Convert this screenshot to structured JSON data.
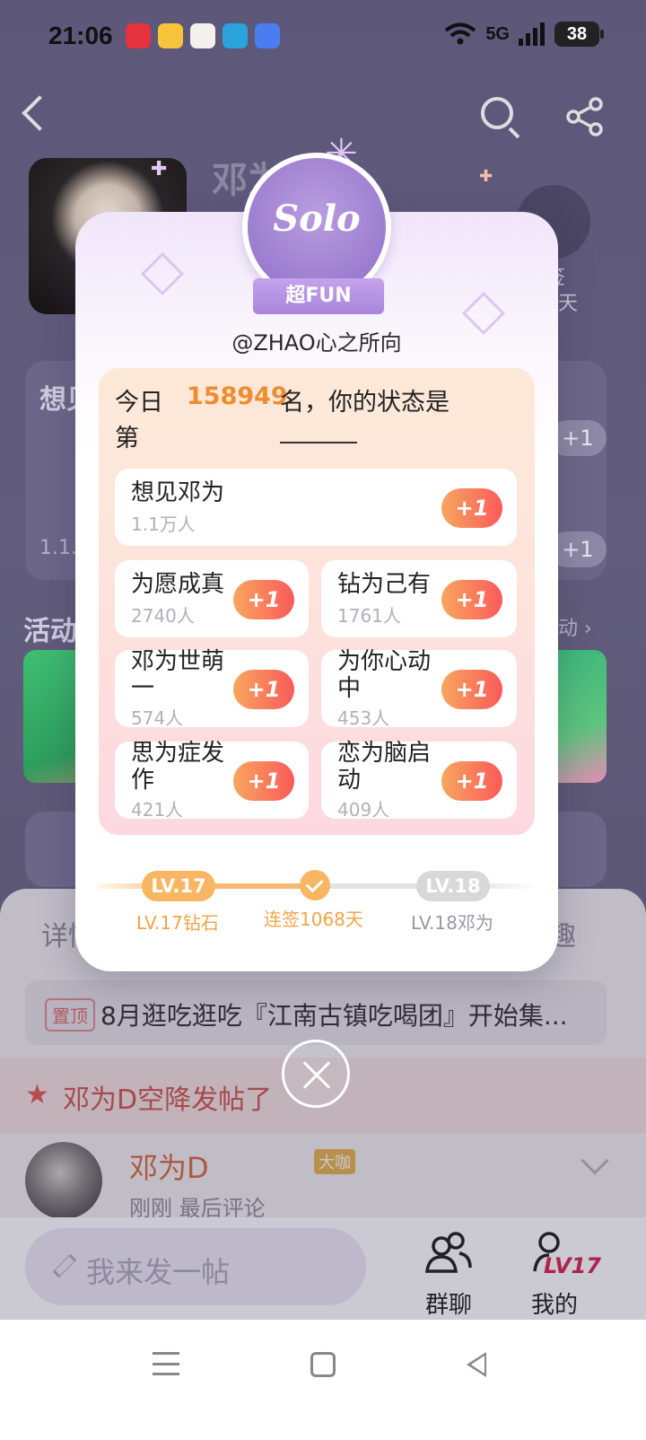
{
  "status_bar": {
    "time": "21:06",
    "network": "5G",
    "battery": "38",
    "app_icons": [
      "xiaohongshu-icon",
      "weibo-icon",
      "avatar-app-icon",
      "telegram-icon",
      "star-app-icon"
    ],
    "app_icon_colors": [
      "#e5323c",
      "#f6c43a",
      "#f4f0ee",
      "#2aa3dd",
      "#4b7df0"
    ]
  },
  "background": {
    "title": "邓为",
    "checkin_label": "签",
    "checkin_days": "8天",
    "section_want": "想见",
    "count_partial": "1.1...",
    "activity_title": "活动",
    "activity_more": "动 ›"
  },
  "modal": {
    "badge_text": "Solo",
    "ribbon": "超FUN",
    "handle": "@ZHAO心之所向",
    "rank_prefix_1": "今日",
    "rank_prefix_2": "第",
    "rank_number": "158949",
    "rank_suffix": "名，你的状态是",
    "options": [
      {
        "label": "想见邓为",
        "count": "1.1万人",
        "action": "+1"
      },
      {
        "label": "为愿成真",
        "count": "2740人",
        "action": "+1"
      },
      {
        "label": "钻为己有",
        "count": "1761人",
        "action": "+1"
      },
      {
        "label": "邓为世萌一",
        "count": "574人",
        "action": "+1"
      },
      {
        "label": "为你心动中",
        "count": "453人",
        "action": "+1"
      },
      {
        "label": "思为症发作",
        "count": "421人",
        "action": "+1"
      },
      {
        "label": "恋为脑启动",
        "count": "409人",
        "action": "+1"
      }
    ],
    "progress": {
      "current_level": "LV.17",
      "next_level": "LV.18",
      "current_caption": "LV.17钻石",
      "mid_caption": "连签1068天",
      "next_caption": "LV.18邓为"
    }
  },
  "feed": {
    "tab_left": "详情",
    "tab_right": "趣",
    "pinned_badge": "置顶",
    "pinned_text": "8月逛吃逛吃『江南古镇吃喝团』开始集...",
    "airdrop_text": "邓为D空降发帖了",
    "user_name": "邓为D",
    "user_badge": "大咖",
    "user_sub": "刚刚 最后评论"
  },
  "bottom_bar": {
    "post_placeholder": "我来发一帖",
    "group_chat": "群聊",
    "mine": "我的",
    "mine_level": "LV17"
  },
  "colors": {
    "accent_orange": "#f08c2f",
    "plus_gradient_start": "#f7a65f",
    "plus_gradient_end": "#fb5a5a",
    "badge_purple": "#9b7ccf"
  }
}
